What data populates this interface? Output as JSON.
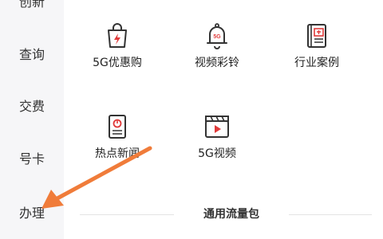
{
  "sidebar": {
    "items": [
      {
        "label": "创新"
      },
      {
        "label": "查询"
      },
      {
        "label": "交费"
      },
      {
        "label": "号卡"
      },
      {
        "label": "办理"
      }
    ]
  },
  "services": [
    {
      "label": "5G优惠购",
      "icon": "shopping-bag-5g-icon"
    },
    {
      "label": "视频彩铃",
      "icon": "bell-5g-icon"
    },
    {
      "label": "行业案例",
      "icon": "case-book-icon"
    },
    {
      "label": "热点新闻",
      "icon": "news-document-icon"
    },
    {
      "label": "5G视频",
      "icon": "video-clapper-icon"
    }
  ],
  "section": {
    "title": "通用流量包"
  },
  "colors": {
    "accent": "#e03a3a",
    "icon_stroke": "#333333",
    "arrow": "#f07c3a",
    "sidebar_bg": "#f6f6f8"
  }
}
